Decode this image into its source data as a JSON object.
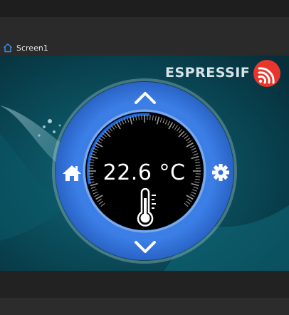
{
  "tab": {
    "label": "Screen1",
    "icon": "home-outline-icon"
  },
  "brand": {
    "name": "ESPRESSIF",
    "logo_icon": "espressif-logo-icon"
  },
  "thermostat": {
    "temperature": "22.6 °C",
    "up_icon": "chevron-up-icon",
    "down_icon": "chevron-down-icon",
    "home_icon": "home-icon",
    "settings_icon": "gear-icon",
    "thermometer_icon": "thermometer-icon",
    "arc_color": "#1565e0",
    "ring_color": "#2f6fd8"
  }
}
